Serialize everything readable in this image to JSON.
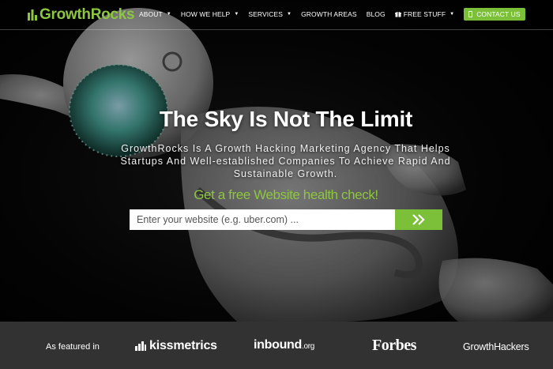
{
  "brand": {
    "logo_text": "GrowthRocks",
    "accent": "#8dc63f"
  },
  "nav": {
    "items": [
      {
        "label": "ABOUT",
        "has_dropdown": true
      },
      {
        "label": "HOW WE HELP",
        "has_dropdown": true
      },
      {
        "label": "SERVICES",
        "has_dropdown": true
      },
      {
        "label": "GROWTH AREAS",
        "has_dropdown": false
      },
      {
        "label": "BLOG",
        "has_dropdown": false
      },
      {
        "label": "FREE STUFF",
        "has_dropdown": true,
        "icon": "gift-icon"
      }
    ],
    "contact_label": "CONTACT US",
    "contact_icon": "phone-icon"
  },
  "hero": {
    "headline": "The Sky Is Not The Limit",
    "subtext": "GrowthRocks Is A Growth Hacking Marketing Agency That Helps Startups And Well-established Companies To Achieve Rapid And Sustainable Growth.",
    "cta_text": "Get a free Website health check!",
    "input_placeholder": "Enter your website (e.g. uber.com) ...",
    "submit_icon": "double-chevron-right-icon"
  },
  "featured": {
    "label": "As featured in",
    "brands": {
      "kissmetrics": "kissmetrics",
      "inbound_main": "inbound",
      "inbound_suffix": ".org",
      "forbes": "Forbes",
      "growthhackers": "GrowthHackers"
    }
  }
}
